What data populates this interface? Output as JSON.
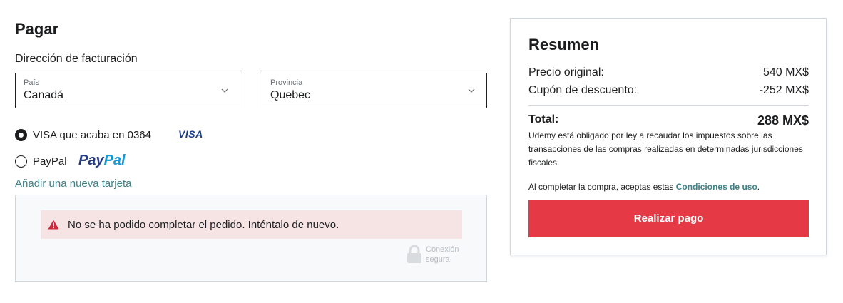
{
  "checkout": {
    "title": "Pagar",
    "billing_label": "Dirección de facturación",
    "country": {
      "label": "País",
      "value": "Canadá"
    },
    "province": {
      "label": "Provincia",
      "value": "Quebec"
    },
    "payment_options": [
      {
        "label": "VISA que acaba en 0364",
        "logo": "VISA",
        "selected": true
      },
      {
        "label": "PayPal",
        "logo_part1": "Pay",
        "logo_part2": "Pal",
        "selected": false
      }
    ],
    "add_card_link": "Añadir una nueva tarjeta",
    "error_message": "No se ha podido completar el pedido. Inténtalo de nuevo.",
    "secure_line1": "Conexión",
    "secure_line2": "segura"
  },
  "summary": {
    "title": "Resumen",
    "original_label": "Precio original:",
    "original_value": "540 MX$",
    "discount_label": "Cupón de descuento:",
    "discount_value": "-252 MX$",
    "total_label": "Total:",
    "total_value": "288 MX$",
    "tax_note": "Udemy está obligado por ley a recaudar los impuestos sobre las transacciones de las compras realizadas en determinadas jurisdicciones fiscales.",
    "terms_prefix": "Al completar la compra, aceptas estas ",
    "terms_link": "Condiciones de uso",
    "terms_suffix": ".",
    "pay_button": "Realizar pago"
  },
  "colors": {
    "accent_link": "#3d8287",
    "pay_button": "#e63946",
    "error_bg": "#f6e4e4",
    "error_icon": "#d0253a"
  }
}
